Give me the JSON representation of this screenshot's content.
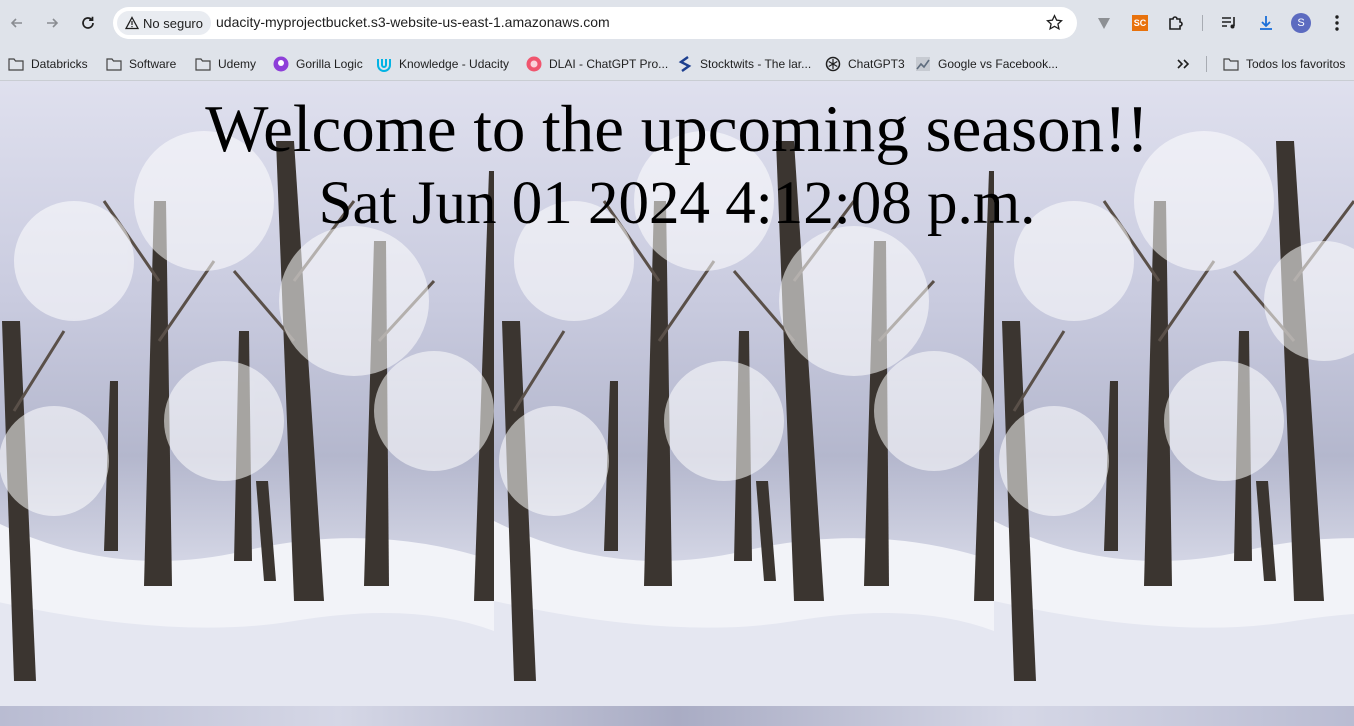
{
  "toolbar": {
    "security_chip": "No seguro",
    "url": "udacity-myprojectbucket.s3-website-us-east-1.amazonaws.com",
    "extension_sc_label": "SC",
    "profile_initial": "S"
  },
  "bookmarks": [
    {
      "label": "Databricks",
      "icon": "folder-icon"
    },
    {
      "label": "Software",
      "icon": "folder-icon"
    },
    {
      "label": "Udemy",
      "icon": "folder-icon"
    },
    {
      "label": "Gorilla Logic",
      "icon": "gorilla-logic-icon"
    },
    {
      "label": "Knowledge - Udacity",
      "icon": "udacity-icon"
    },
    {
      "label": "DLAI - ChatGPT Pro...",
      "icon": "dlai-icon"
    },
    {
      "label": "Stocktwits - The lar...",
      "icon": "stocktwits-icon"
    },
    {
      "label": "ChatGPT3",
      "icon": "openai-icon"
    },
    {
      "label": "Google vs Facebook...",
      "icon": "chart-icon"
    }
  ],
  "all_bookmarks_label": "Todos los favoritos",
  "page": {
    "heading": "Welcome to the upcoming season!!",
    "datetime": "Sat Jun 01 2024 4:12:08 p.m."
  },
  "colors": {
    "chrome_bg": "#dfe3ea",
    "snow_tint": "#c9cbdf",
    "trunk": "#3b3530"
  }
}
